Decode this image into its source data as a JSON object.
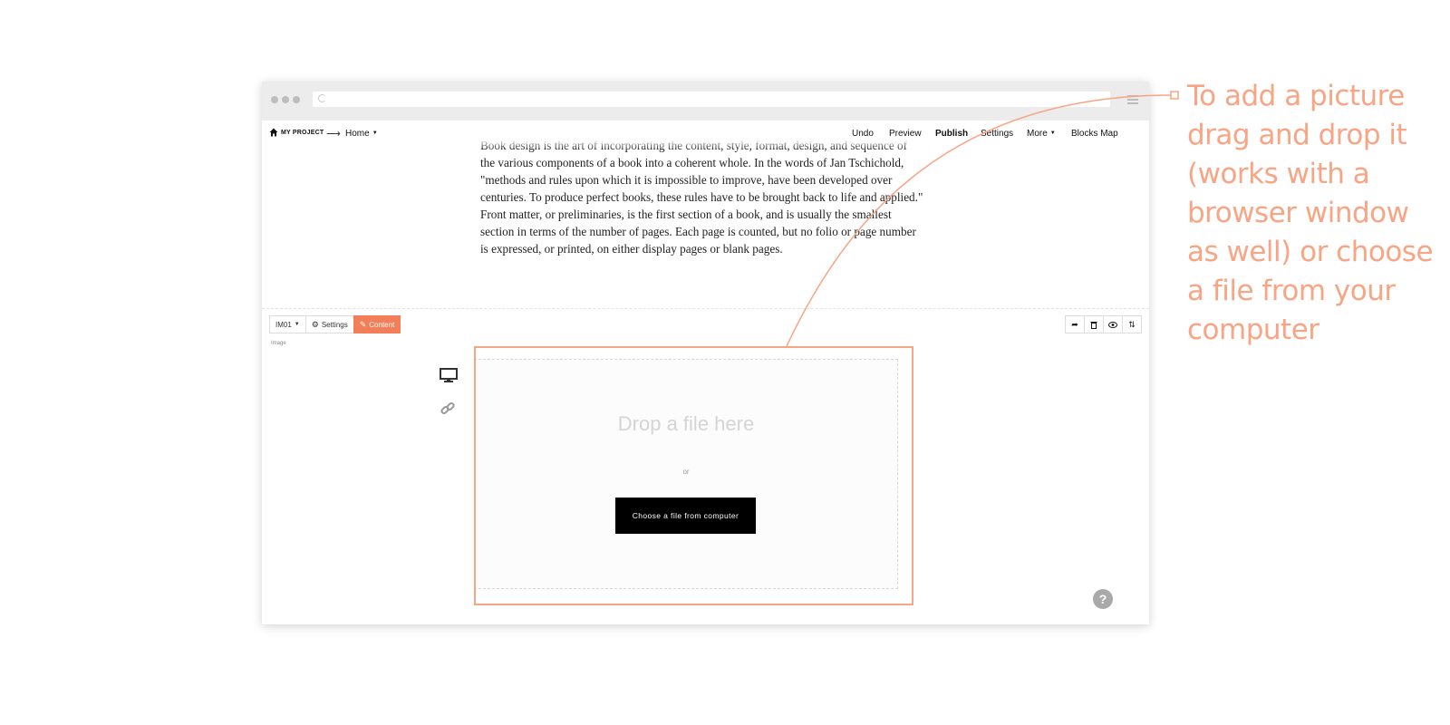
{
  "nav": {
    "project": "MY PROJECT",
    "page": "Home",
    "links": [
      "Undo",
      "Preview",
      "Publish",
      "Settings",
      "More",
      "Blocks Map"
    ]
  },
  "content": {
    "paragraphs": [
      "Book design is the art of incorporating the content, style, format, design, and sequence of the various components of a book into a coherent whole. In the words of Jan Tschichold, \"methods and rules upon which it is impossible to improve, have been developed over centuries. To produce perfect books, these rules have to be brought back to life and applied.\"",
      "Front matter, or preliminaries, is the first section of a book, and is usually the smallest section in terms of the number of pages. Each page is counted, but no folio or page number is expressed, or printed, on either display pages or blank pages."
    ]
  },
  "block": {
    "id": "IM01",
    "settings_label": "Settings",
    "content_label": "Content",
    "type_label": "Image"
  },
  "dropzone": {
    "title": "Drop a file here",
    "or": "or",
    "button": "Choose a file from computer"
  },
  "annotation": {
    "text": "To add a picture drag and drop it (works with a browser window as well) or choose a file from your computer"
  },
  "colors": {
    "accent": "#f47e57",
    "annotation": "#f7a584"
  }
}
